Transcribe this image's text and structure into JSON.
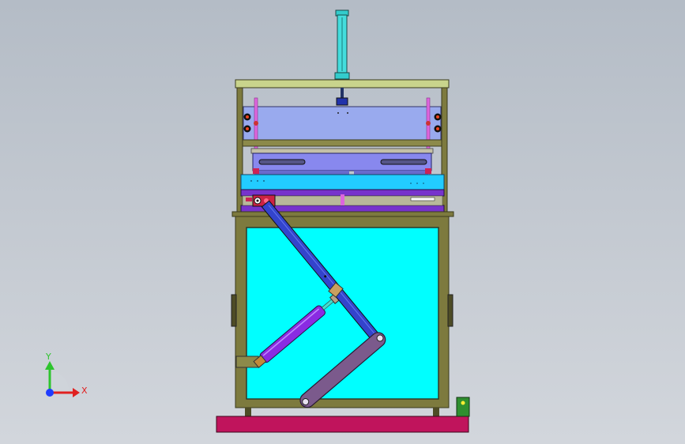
{
  "triad": {
    "y_label": "Y",
    "x_label": "X",
    "colors": {
      "y": "#2ec42e",
      "x": "#e02020",
      "z": "#1f3cff"
    }
  },
  "colors": {
    "background": "#c2c8d0",
    "frame": "#7d7a3e",
    "frame_dark": "#4e4c26",
    "top_plate": "#c9d48c",
    "window": "#00ffff",
    "light_blue_plate": "#99aaee",
    "cyan_plate": "#22ccff",
    "purple_bar": "#7733cc",
    "mold": "#8888ee",
    "link_arm": "#3344cc",
    "lower_arm": "#7b5a8c",
    "cylinder": "#8a2be2",
    "base": "#c0145c",
    "cylinder_rod": "#44ddcc",
    "guide_rod": "#dd66dd",
    "switch_box": "#2f8f2f"
  }
}
